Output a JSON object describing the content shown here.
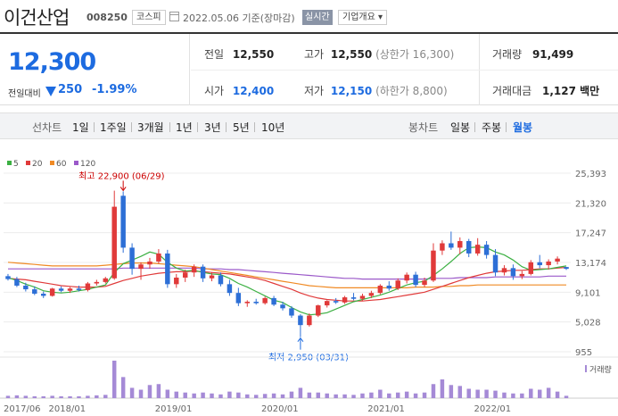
{
  "header": {
    "company": "이건산업",
    "code": "008250",
    "market": "코스피",
    "date": "2022.05.06 기준(장마감)",
    "realtime": "실시간",
    "overview": "기업개요 ▾"
  },
  "price": {
    "current": "12,300",
    "change_label": "전일대비",
    "change": "250",
    "change_pct": "-1.99%",
    "direction": "down",
    "color_down": "#1d6be0",
    "color_up": "#e03a3a"
  },
  "summary": {
    "prev_close": {
      "label": "전일",
      "value": "12,550"
    },
    "open": {
      "label": "시가",
      "value": "12,400"
    },
    "high": {
      "label": "고가",
      "value": "12,550",
      "extra": "(상한가 16,300)"
    },
    "low": {
      "label": "저가",
      "value": "12,150",
      "extra": "(하한가 8,800)"
    },
    "volume": {
      "label": "거래량",
      "value": "91,499"
    },
    "amount": {
      "label": "거래대금",
      "value": "1,127 백만"
    }
  },
  "tabs": {
    "line_chart_label": "선차트",
    "periods": [
      "1일",
      "1주일",
      "3개월",
      "1년",
      "3년",
      "5년",
      "10년"
    ],
    "candle_chart_label": "봉차트",
    "candle_periods": [
      "일봉",
      "주봉",
      "월봉"
    ],
    "active_candle": "월봉"
  },
  "chart_data": {
    "type": "candlestick",
    "legend": [
      {
        "name": "5",
        "color": "#3cb043"
      },
      {
        "name": "20",
        "color": "#e03a3a"
      },
      {
        "name": "60",
        "color": "#f08a24"
      },
      {
        "name": "120",
        "color": "#9b59c9"
      }
    ],
    "y_ticks": [
      "25,393",
      "21,320",
      "17,247",
      "13,174",
      "9,101",
      "5,028",
      "955"
    ],
    "ylim": [
      955,
      25393
    ],
    "x_ticks": [
      "2017/06",
      "2018/01",
      "2019/01",
      "2020/01",
      "2021/01",
      "2022/01"
    ],
    "volume_label": "거래량",
    "high_annotation": "최고 22,900 (06/29)",
    "low_annotation": "최저 2,950 (03/31)",
    "annotations": [
      {
        "text": "최고 22,900 (06/29)",
        "index": 13,
        "value": 22900,
        "kind": "high"
      },
      {
        "text": "최저 2,950 (03/31)",
        "index": 33,
        "value": 2950,
        "kind": "low"
      }
    ],
    "candles": [
      [
        11300,
        11600,
        10700,
        10900
      ],
      [
        10900,
        11200,
        9800,
        10000
      ],
      [
        10000,
        10400,
        9200,
        9500
      ],
      [
        9500,
        9900,
        8700,
        8900
      ],
      [
        8900,
        9200,
        8300,
        8600
      ],
      [
        8600,
        9700,
        8500,
        9600
      ],
      [
        9600,
        9900,
        9100,
        9300
      ],
      [
        9300,
        9800,
        9000,
        9600
      ],
      [
        9600,
        10000,
        9200,
        9400
      ],
      [
        9400,
        10500,
        9200,
        10300
      ],
      [
        10300,
        10800,
        10000,
        10500
      ],
      [
        10500,
        11200,
        10300,
        11000
      ],
      [
        11000,
        23000,
        10800,
        20800
      ],
      [
        22300,
        22900,
        14500,
        15200
      ],
      [
        15200,
        15800,
        11500,
        12300
      ],
      [
        12300,
        13200,
        10800,
        12900
      ],
      [
        12900,
        13800,
        12300,
        13300
      ],
      [
        13300,
        15000,
        13000,
        14400
      ],
      [
        14400,
        14900,
        9700,
        10200
      ],
      [
        10200,
        11600,
        9700,
        11100
      ],
      [
        11100,
        12200,
        10500,
        11800
      ],
      [
        11800,
        12900,
        11200,
        12600
      ],
      [
        12600,
        12900,
        10500,
        11000
      ],
      [
        11000,
        11800,
        10600,
        11400
      ],
      [
        11400,
        11800,
        9900,
        10200
      ],
      [
        10200,
        10800,
        8600,
        9000
      ],
      [
        9000,
        9700,
        7200,
        7600
      ],
      [
        7600,
        8000,
        7100,
        7800
      ],
      [
        7800,
        8200,
        7400,
        7600
      ],
      [
        7600,
        8500,
        7400,
        8300
      ],
      [
        8300,
        8600,
        7200,
        7400
      ],
      [
        7400,
        7800,
        6600,
        6900
      ],
      [
        6900,
        7200,
        5600,
        5900
      ],
      [
        5900,
        6100,
        2950,
        4600
      ],
      [
        4600,
        6200,
        4400,
        5900
      ],
      [
        5900,
        7400,
        5700,
        7300
      ],
      [
        7300,
        8000,
        7000,
        7900
      ],
      [
        7900,
        8300,
        7500,
        7700
      ],
      [
        7700,
        8600,
        7500,
        8400
      ],
      [
        8400,
        9000,
        8000,
        8200
      ],
      [
        8200,
        8900,
        7900,
        8600
      ],
      [
        8600,
        9300,
        8300,
        9000
      ],
      [
        9000,
        10200,
        8800,
        10000
      ],
      [
        10000,
        10600,
        9300,
        9600
      ],
      [
        9600,
        11000,
        9400,
        10700
      ],
      [
        10700,
        11800,
        10300,
        11500
      ],
      [
        11500,
        11900,
        9800,
        10100
      ],
      [
        10100,
        11100,
        9800,
        10700
      ],
      [
        10700,
        15800,
        10500,
        14800
      ],
      [
        14800,
        16200,
        14200,
        15800
      ],
      [
        15800,
        17400,
        14900,
        15200
      ],
      [
        15200,
        16600,
        14300,
        16100
      ],
      [
        16100,
        16400,
        13900,
        14400
      ],
      [
        14400,
        16500,
        14100,
        15600
      ],
      [
        15600,
        16100,
        13700,
        14200
      ],
      [
        14200,
        15000,
        11300,
        11800
      ],
      [
        11800,
        12800,
        11400,
        12400
      ],
      [
        12400,
        12900,
        10800,
        11300
      ],
      [
        11300,
        12000,
        10900,
        11600
      ],
      [
        11600,
        13500,
        11400,
        13200
      ],
      [
        13200,
        14200,
        12400,
        12800
      ],
      [
        12800,
        13600,
        12200,
        13300
      ],
      [
        13300,
        14000,
        12900,
        13700
      ],
      [
        12550,
        12550,
        12150,
        12300
      ]
    ],
    "ma5": [
      11100,
      10700,
      10200,
      9800,
      9300,
      9100,
      9000,
      9100,
      9300,
      9500,
      9800,
      10100,
      11800,
      13000,
      13500,
      14000,
      14600,
      14300,
      13200,
      12400,
      12000,
      12100,
      11800,
      11600,
      11500,
      11000,
      10300,
      9800,
      9200,
      8600,
      8000,
      7700,
      7000,
      6400,
      6000,
      6100,
      6300,
      6800,
      7300,
      7800,
      8100,
      8400,
      8700,
      9100,
      9600,
      10100,
      10400,
      10600,
      11400,
      12300,
      13300,
      14400,
      15200,
      15300,
      15200,
      14600,
      14200,
      13500,
      12600,
      12100,
      12200,
      12300,
      12500,
      12700
    ],
    "ma20": [
      11000,
      10900,
      10800,
      10600,
      10400,
      10200,
      10000,
      9900,
      9800,
      9800,
      9800,
      9900,
      10300,
      10700,
      11000,
      11300,
      11500,
      11700,
      11800,
      11900,
      11900,
      12000,
      11900,
      11800,
      11700,
      11600,
      11400,
      11200,
      11000,
      10700,
      10300,
      9900,
      9500,
      9000,
      8600,
      8300,
      8100,
      8000,
      7900,
      7900,
      7900,
      8000,
      8100,
      8300,
      8500,
      8700,
      8900,
      9100,
      9500,
      9900,
      10300,
      10700,
      11100,
      11400,
      11700,
      11900,
      12000,
      12100,
      12100,
      12200,
      12300,
      12300,
      12400,
      12500
    ],
    "ma60": [
      13200,
      13100,
      13000,
      12900,
      12800,
      12700,
      12700,
      12700,
      12700,
      12700,
      12700,
      12800,
      12900,
      13000,
      13100,
      13100,
      13100,
      13000,
      12900,
      12800,
      12700,
      12600,
      12400,
      12200,
      12000,
      11800,
      11600,
      11400,
      11200,
      11000,
      10800,
      10600,
      10400,
      10200,
      10000,
      9900,
      9800,
      9700,
      9700,
      9700,
      9700,
      9700,
      9700,
      9700,
      9700,
      9700,
      9800,
      9800,
      9800,
      9900,
      9900,
      10000,
      10000,
      10100,
      10100,
      10100,
      10100,
      10100,
      10100,
      10100,
      10100,
      10100,
      10100,
      10100
    ],
    "ma120": [
      12300,
      12300,
      12300,
      12300,
      12300,
      12300,
      12300,
      12300,
      12300,
      12300,
      12300,
      12300,
      12300,
      12400,
      12400,
      12400,
      12400,
      12400,
      12400,
      12400,
      12400,
      12400,
      12300,
      12300,
      12300,
      12200,
      12200,
      12100,
      12000,
      11900,
      11800,
      11700,
      11600,
      11500,
      11400,
      11300,
      11200,
      11100,
      11000,
      11000,
      10900,
      10900,
      10900,
      10900,
      10900,
      10900,
      10900,
      10900,
      11000,
      11000,
      11000,
      11100,
      11100,
      11100,
      11100,
      11200,
      11200,
      11200,
      11200,
      11200,
      11200,
      11300,
      11300,
      11300
    ],
    "volume": [
      5,
      6,
      5,
      4,
      4,
      5,
      4,
      4,
      4,
      5,
      6,
      7,
      80,
      45,
      22,
      18,
      28,
      30,
      18,
      14,
      12,
      10,
      12,
      10,
      8,
      14,
      12,
      8,
      7,
      9,
      10,
      8,
      14,
      22,
      12,
      12,
      10,
      8,
      8,
      7,
      10,
      12,
      18,
      10,
      12,
      14,
      10,
      12,
      30,
      40,
      28,
      26,
      20,
      18,
      18,
      16,
      12,
      10,
      10,
      20,
      18,
      22,
      14,
      5
    ]
  }
}
